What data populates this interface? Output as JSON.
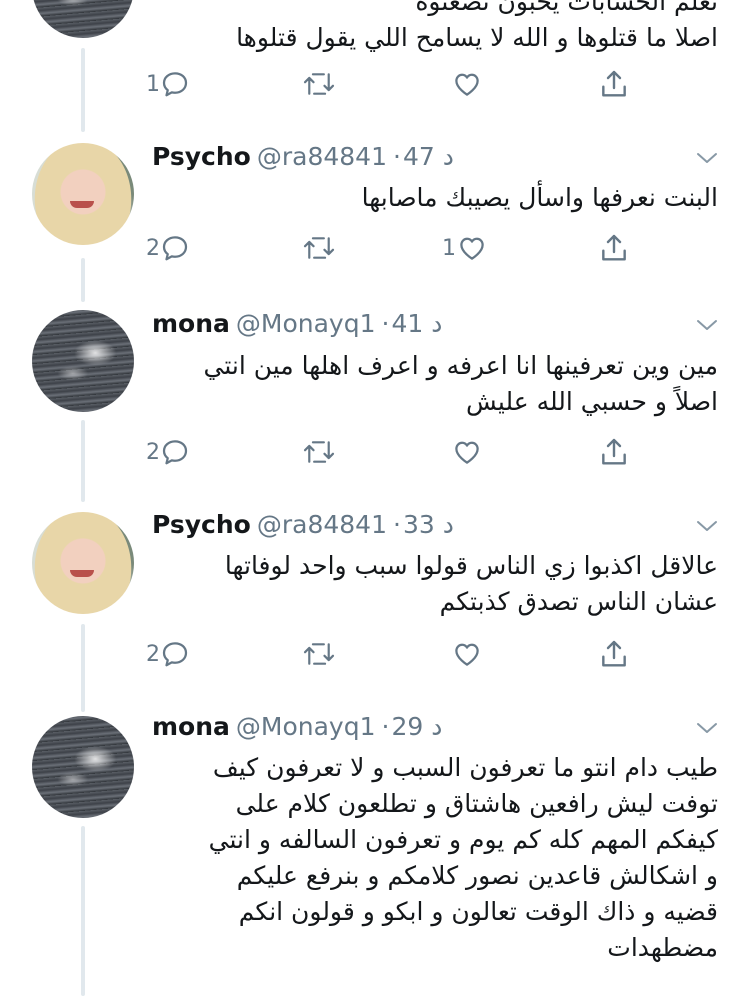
{
  "tweets": [
    {
      "text_lines": [
        "تعلم الحسابات يحبون تصعنوه",
        "اصلا ما قتلوها و الله لا يسامح اللي يقول قتلوها"
      ],
      "actions": {
        "reply_count": "1",
        "retweet_count": "",
        "like_count": ""
      }
    },
    {
      "name": "Psycho",
      "handle": "@ra84841",
      "time": "47 د",
      "text_lines": [
        "البنت نعرفها واسأل يصيبك ماصابها"
      ],
      "actions": {
        "reply_count": "2",
        "retweet_count": "",
        "like_count": "1"
      }
    },
    {
      "name": "mona",
      "handle": "@Monayq1",
      "time": "41 د",
      "text_lines": [
        "مين وين تعرفينها انا اعرفه و اعرف اهلها مين انتي",
        "اصلاً و حسبي الله عليش"
      ],
      "actions": {
        "reply_count": "2",
        "retweet_count": "",
        "like_count": ""
      }
    },
    {
      "name": "Psycho",
      "handle": "@ra84841",
      "time": "33 د",
      "text_lines": [
        "عالاقل اكذبوا زي الناس قولوا سبب واحد لوفاتها",
        "عشان الناس تصدق كذبتكم"
      ],
      "actions": {
        "reply_count": "2",
        "retweet_count": "",
        "like_count": ""
      }
    },
    {
      "name": "mona",
      "handle": "@Monayq1",
      "time": "29 د",
      "text_lines": [
        "طيب دام انتو ما تعرفون السبب و لا تعرفون كيف",
        "توفت ليش رافعين هاشتاق و تطلعون كلام على",
        "كيفكم المهم كله كم يوم و تعرفون السالفه و انتي",
        "و اشكالش قاعدين نصور كلامكم و بنرفع عليكم",
        "قضيه و ذاك الوقت تعالون و ابكو و قولون انكم",
        "مضطهدات"
      ]
    }
  ],
  "icons": {
    "reply": "reply-icon",
    "retweet": "retweet-icon",
    "like": "heart-icon",
    "share": "share-icon",
    "menu": "chevron-down-icon"
  },
  "colors": {
    "icon": "#657786",
    "thread_line": "#e1e8ed",
    "text": "#14171a",
    "secondary": "#657786"
  }
}
